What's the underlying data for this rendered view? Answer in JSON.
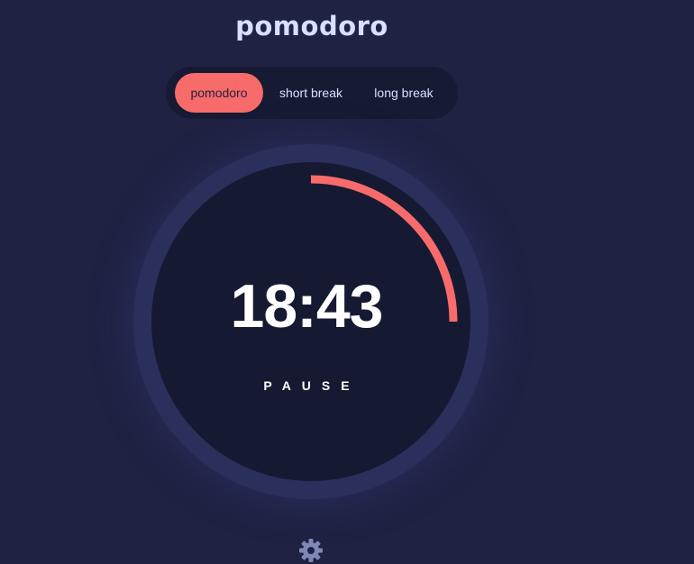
{
  "app": {
    "title": "pomodoro"
  },
  "modes": {
    "active_index": 0,
    "items": [
      {
        "label": "pomodoro"
      },
      {
        "label": "short break"
      },
      {
        "label": "long break"
      }
    ]
  },
  "timer": {
    "time": "18:43",
    "action_label": "PAUSE",
    "progress_fraction": 0.25
  },
  "colors": {
    "background": "#1f2243",
    "accent": "#f86b6b",
    "face": "#161932",
    "title": "#d7e0ff"
  },
  "icons": {
    "settings": "gear-icon"
  }
}
